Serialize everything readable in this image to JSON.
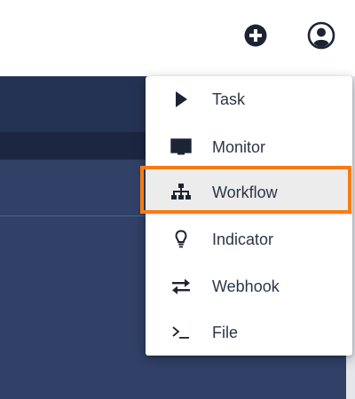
{
  "header": {
    "add_icon": "plus-circle-icon",
    "account_icon": "account-circle-icon"
  },
  "menu": {
    "items": [
      {
        "label": "Task",
        "icon": "play-icon"
      },
      {
        "label": "Monitor",
        "icon": "monitor-icon"
      },
      {
        "label": "Workflow",
        "icon": "sitemap-icon",
        "highlighted": true
      },
      {
        "label": "Indicator",
        "icon": "lightbulb-icon"
      },
      {
        "label": "Webhook",
        "icon": "swap-arrows-icon"
      },
      {
        "label": "File",
        "icon": "terminal-icon"
      }
    ]
  },
  "colors": {
    "highlight_border": "#f57c14",
    "text": "#2b3547",
    "dark_bg": "#304067"
  }
}
